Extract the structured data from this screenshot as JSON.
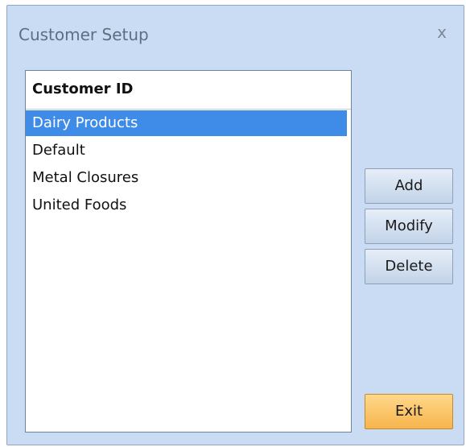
{
  "window": {
    "title": "Customer Setup",
    "close_label": "x"
  },
  "list": {
    "header": "Customer ID",
    "items": [
      {
        "label": "Dairy Products",
        "selected": true
      },
      {
        "label": "Default",
        "selected": false
      },
      {
        "label": "Metal Closures",
        "selected": false
      },
      {
        "label": "United Foods",
        "selected": false
      }
    ]
  },
  "buttons": {
    "add": "Add",
    "modify": "Modify",
    "delete": "Delete",
    "exit": "Exit"
  },
  "colors": {
    "window_bg": "#c9dcf3",
    "selection": "#3f8ce8",
    "exit_button": "#f7b44c"
  }
}
